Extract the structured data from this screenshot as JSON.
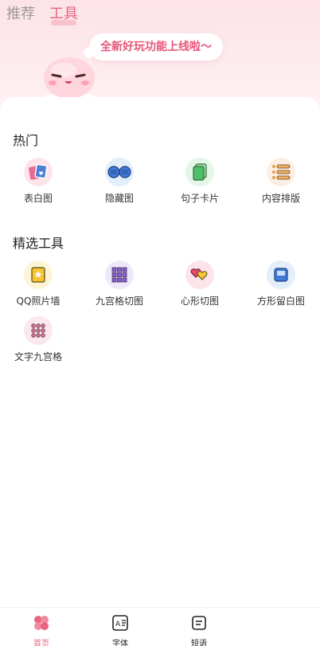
{
  "top_tabs": [
    {
      "label": "推荐"
    },
    {
      "label": "工具"
    }
  ],
  "banner": {
    "text": "全新好玩功能上线啦～"
  },
  "hot": {
    "title": "热门",
    "items": [
      {
        "label": "表白图",
        "icon": "love-photo-icon",
        "bg": "#fde4ea"
      },
      {
        "label": "隐藏图",
        "icon": "hidden-image-icon",
        "bg": "#e3eefb"
      },
      {
        "label": "句子卡片",
        "icon": "sentence-card-icon",
        "bg": "#e3f6e7"
      },
      {
        "label": "内容排版",
        "icon": "layout-list-icon",
        "bg": "#fdeee3"
      }
    ]
  },
  "featured": {
    "title": "精选工具",
    "items": [
      {
        "label": "QQ照片墙",
        "icon": "photo-wall-icon",
        "bg": "#fdf4d8"
      },
      {
        "label": "九宫格切图",
        "icon": "nine-grid-icon",
        "bg": "#efe8fb"
      },
      {
        "label": "心形切图",
        "icon": "heart-cut-icon",
        "bg": "#fde4ea"
      },
      {
        "label": "方形留白图",
        "icon": "square-frame-icon",
        "bg": "#e3eefb"
      },
      {
        "label": "文字九宫格",
        "icon": "text-grid-icon",
        "bg": "#fbe8ee"
      }
    ]
  },
  "bottom_nav": [
    {
      "label": "首页",
      "icon": "clover-home-icon",
      "active": true
    },
    {
      "label": "字体",
      "icon": "font-icon",
      "active": false
    },
    {
      "label": "短语",
      "icon": "phrase-icon",
      "active": false
    }
  ],
  "colors": {
    "accent": "#e8657e",
    "hero_bg": "#fde3e7"
  }
}
